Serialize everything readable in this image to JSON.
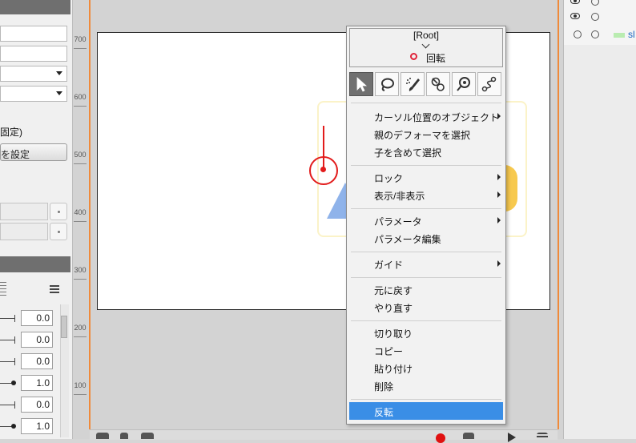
{
  "left_panel": {
    "fixed_label": "固定)",
    "set_button": "を設定",
    "params": [
      "0.0",
      "0.0",
      "0.0",
      "1.0",
      "0.0",
      "1.0"
    ]
  },
  "ruler": {
    "labels": [
      "700",
      "600",
      "500",
      "400",
      "300",
      "200",
      "100"
    ]
  },
  "right_panel": {
    "visible_label": "sl"
  },
  "popup": {
    "root_label": "[Root]",
    "deformer_label": "回転",
    "menu_groups": [
      [
        {
          "label": "カーソル位置のオブジェクト",
          "submenu": true
        },
        {
          "label": "親のデフォーマを選択",
          "submenu": false
        },
        {
          "label": "子を含めて選択",
          "submenu": false
        }
      ],
      [
        {
          "label": "ロック",
          "submenu": true
        },
        {
          "label": "表示/非表示",
          "submenu": true
        }
      ],
      [
        {
          "label": "パラメータ",
          "submenu": true
        },
        {
          "label": "パラメータ編集",
          "submenu": false
        }
      ],
      [
        {
          "label": "ガイド",
          "submenu": true
        }
      ],
      [
        {
          "label": "元に戻す",
          "submenu": false
        },
        {
          "label": "やり直す",
          "submenu": false
        }
      ],
      [
        {
          "label": "切り取り",
          "submenu": false
        },
        {
          "label": "コピー",
          "submenu": false
        },
        {
          "label": "貼り付け",
          "submenu": false
        },
        {
          "label": "削除",
          "submenu": false
        }
      ],
      [
        {
          "label": "反転",
          "submenu": false,
          "highlighted": true
        }
      ]
    ]
  },
  "colors": {
    "accent_orange": "#f08a3a",
    "highlight_blue": "#3a8ee6",
    "rotation_red": "#e21b1b"
  }
}
